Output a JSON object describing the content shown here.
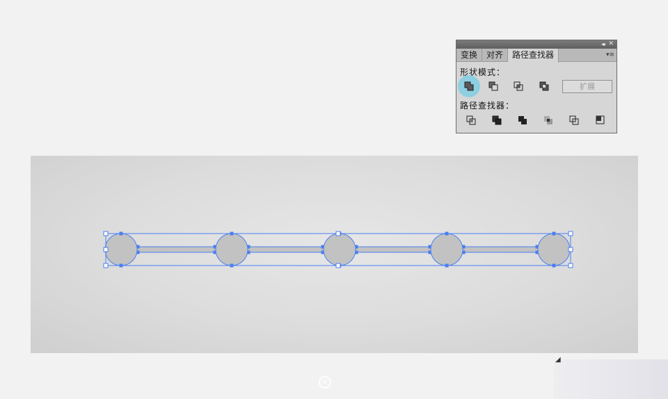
{
  "panel": {
    "tabs": [
      "变换",
      "对齐",
      "路径查找器"
    ],
    "active_tab": 2,
    "collapse_glyph": "◂◂",
    "close_glyph": "✕",
    "menu_glyph": "▾≡",
    "shape_modes_label": "形状模式：",
    "pathfinders_label": "路径查找器：",
    "expand_label": "扩展",
    "shape_mode_buttons": [
      "unite-icon",
      "minus-front-icon",
      "intersect-icon",
      "exclude-icon"
    ],
    "pathfinder_buttons": [
      "divide-icon",
      "trim-icon",
      "merge-icon",
      "crop-icon",
      "outline-icon",
      "minus-back-icon"
    ],
    "highlighted_button": "unite-icon"
  },
  "canvas": {
    "shape_fill": "#c2c2c2",
    "selection_color": "#4a7ff0",
    "circle_count": 5
  },
  "corner_glyph": "◢",
  "watermark_glyph": "⊕"
}
